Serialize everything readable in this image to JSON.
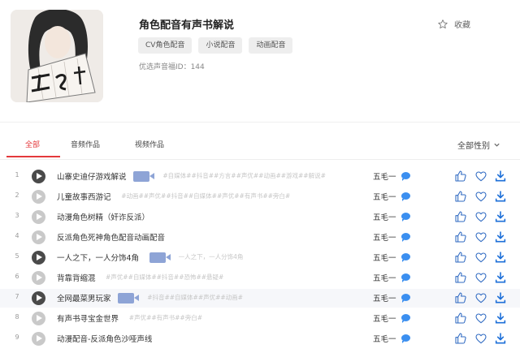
{
  "header": {
    "title": "角色配音有声书解说",
    "tags": [
      "CV角色配音",
      "小说配音",
      "动画配音"
    ],
    "voice_id": "优选声音福ID：144",
    "fav_label": "收藏",
    "avatar_calligraphy": "五毛一"
  },
  "tabs": {
    "items": [
      "全部",
      "音频作品",
      "视频作品"
    ],
    "active": 0,
    "gender_filter": "全部性别"
  },
  "colors": {
    "accent": "#e4393c",
    "link_blue": "#3b8ff0",
    "download_blue": "#1d6fd8",
    "icon_blue": "#2f6ac2"
  },
  "works": [
    {
      "num": "1",
      "title": "山寨史迪仔游戏解说",
      "video": true,
      "tags": "#自媒体##抖音##方言##声优##动画##游戏##解说#",
      "author": "五毛一",
      "play": "dark",
      "highlight": false
    },
    {
      "num": "2",
      "title": "儿童故事西游记",
      "video": false,
      "tags": "#动画##声优##抖音##自媒体##声优##有声书##旁白#",
      "author": "五毛一",
      "play": "light",
      "highlight": false
    },
    {
      "num": "3",
      "title": "动漫角色树精（奸诈反派）",
      "video": false,
      "tags": "",
      "author": "五毛一",
      "play": "light",
      "highlight": false
    },
    {
      "num": "4",
      "title": "反派角色死神角色配音动画配音",
      "video": false,
      "tags": "",
      "author": "五毛一",
      "play": "light",
      "highlight": false
    },
    {
      "num": "5",
      "title": "一人之下，一人分饰4角",
      "video": true,
      "tags": "一人之下，一人分饰4角",
      "author": "五毛一",
      "play": "dark",
      "highlight": false
    },
    {
      "num": "6",
      "title": "背靠背缩混",
      "video": false,
      "tags": "#声优##自媒体##抖音##恐怖##悬疑#",
      "author": "五毛一",
      "play": "light",
      "highlight": false
    },
    {
      "num": "7",
      "title": "全网最菜男玩家",
      "video": true,
      "tags": "#抖音##自媒体##声优##动画#",
      "author": "五毛一",
      "play": "dark",
      "highlight": true
    },
    {
      "num": "8",
      "title": "有声书寻宝金世界",
      "video": false,
      "tags": "#声优##有声书##旁白#",
      "author": "五毛一",
      "play": "light",
      "highlight": false
    },
    {
      "num": "9",
      "title": "动漫配音-反派角色沙哑声线",
      "video": false,
      "tags": "",
      "author": "五毛一",
      "play": "light",
      "highlight": false
    }
  ]
}
